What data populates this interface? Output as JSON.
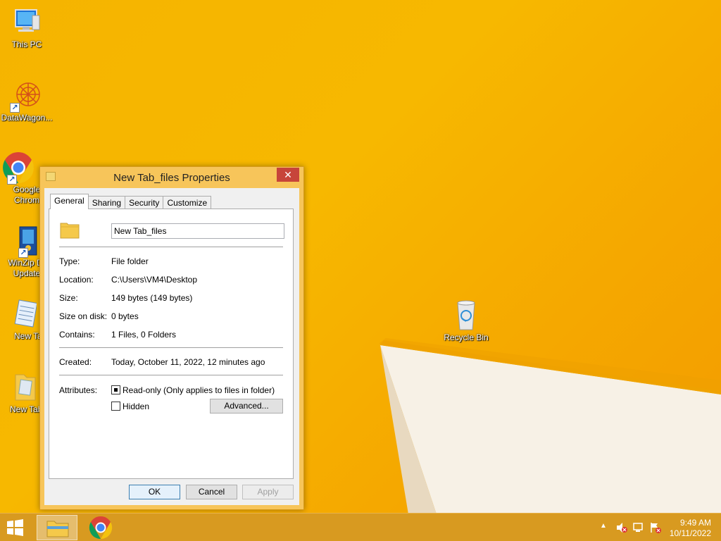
{
  "desktop": {
    "icons": [
      {
        "label": "This PC"
      },
      {
        "label": "DataWagon..."
      },
      {
        "label": "Google Chrome",
        "line1": "Google",
        "line2": "Chrom"
      },
      {
        "label": "WinZip Driver Updater",
        "line1": "WinZip Dr",
        "line2": "Update"
      },
      {
        "label": "New Ta"
      },
      {
        "label": "New Tab_"
      },
      {
        "label": "Recycle Bin"
      }
    ]
  },
  "dialog": {
    "title": "New Tab_files Properties",
    "close_glyph": "✕",
    "tabs": [
      "General",
      "Sharing",
      "Security",
      "Customize"
    ],
    "active_tab": "General",
    "name_value": "New Tab_files",
    "rows": {
      "type": {
        "label": "Type:",
        "value": "File folder"
      },
      "location": {
        "label": "Location:",
        "value": "C:\\Users\\VM4\\Desktop"
      },
      "size": {
        "label": "Size:",
        "value": "149 bytes (149 bytes)"
      },
      "size_on_disk": {
        "label": "Size on disk:",
        "value": "0 bytes"
      },
      "contains": {
        "label": "Contains:",
        "value": "1 Files, 0 Folders"
      },
      "created": {
        "label": "Created:",
        "value": "Today, October 11, 2022, 12 minutes ago"
      }
    },
    "attributes": {
      "label": "Attributes:",
      "readonly": {
        "label": "Read-only (Only applies to files in folder)",
        "state": "indeterminate"
      },
      "hidden": {
        "label": "Hidden",
        "checked": false
      },
      "advanced_button": "Advanced..."
    },
    "buttons": {
      "ok": "OK",
      "cancel": "Cancel",
      "apply": "Apply"
    }
  },
  "taskbar": {
    "time": "9:49 AM",
    "date": "10/11/2022"
  },
  "colors": {
    "wallpaper": "#f5b400",
    "taskbar": "#d89a20",
    "dialog_frame": "#f7c55a",
    "close_button": "#c7453a"
  }
}
